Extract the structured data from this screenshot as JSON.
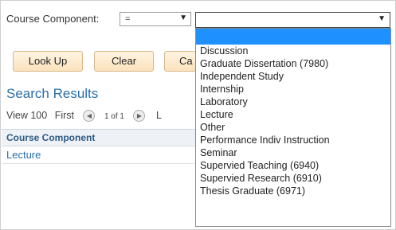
{
  "search_form": {
    "field_label": "Course Component:",
    "operator_value": "=",
    "value_selected": ""
  },
  "buttons": {
    "lookup": "Look Up",
    "clear": "Clear",
    "cancel_partial": "Ca"
  },
  "results": {
    "title": "Search Results",
    "view_label": "View 100",
    "first_label": "First",
    "pages": "1 of 1",
    "last_partial": "L",
    "column_header": "Course Component",
    "rows": [
      "Lecture"
    ]
  },
  "dropdown": {
    "options": [
      "",
      "Discussion",
      "Graduate Dissertation (7980)",
      "Independent Study",
      "Internship",
      "Laboratory",
      "Lecture",
      "Other",
      "Performance Indiv Instruction",
      "Seminar",
      "Supervied Teaching (6940)",
      "Supervied Research (6910)",
      "Thesis Graduate (6971)"
    ]
  },
  "colors": {
    "link_blue": "#2a6fa8",
    "selected_option": "#1e90ff",
    "button_fill": "#fbe2bd"
  },
  "icons": {
    "dropdown_arrow": "chevron-down-icon",
    "previous": "previous-icon",
    "next": "next-icon"
  }
}
